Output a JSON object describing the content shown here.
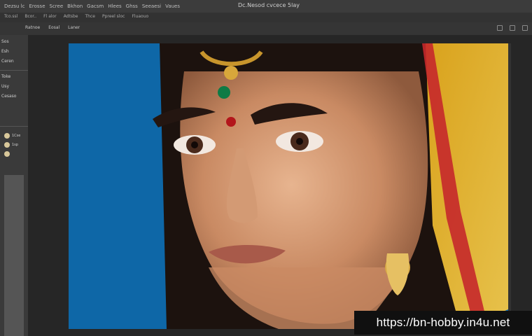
{
  "window": {
    "title": "Dc.Nesod cvcece 5lay"
  },
  "menu": {
    "items": [
      "Dezsu lc",
      "Erosse",
      "Scree",
      "Bkhon",
      "Gacsm",
      "Hlees",
      "Ghss",
      "Seeaesi",
      "Vaues"
    ]
  },
  "options": {
    "labels": [
      "Tco.ssl",
      "Bcor..",
      "Fl alor",
      "Adtsbe",
      "Thce",
      "Ppreel sloc",
      "Fluaouo"
    ]
  },
  "tabs": {
    "items": [
      "Ratnoe",
      "Eosal",
      "Laner"
    ]
  },
  "left_panel": {
    "rows": [
      "Sos",
      "Esh",
      "Ceren",
      "Toke",
      "Usy",
      "Cesaso"
    ],
    "layer_labels": [
      "1Cse",
      "1sp",
      ""
    ]
  },
  "watermark": {
    "text": "https://bn-hobby.in4u.net"
  },
  "colors": {
    "background_blue": "#0e6aa8",
    "ui_dark": "#2b2b2b",
    "panel": "#3a3a3a"
  }
}
